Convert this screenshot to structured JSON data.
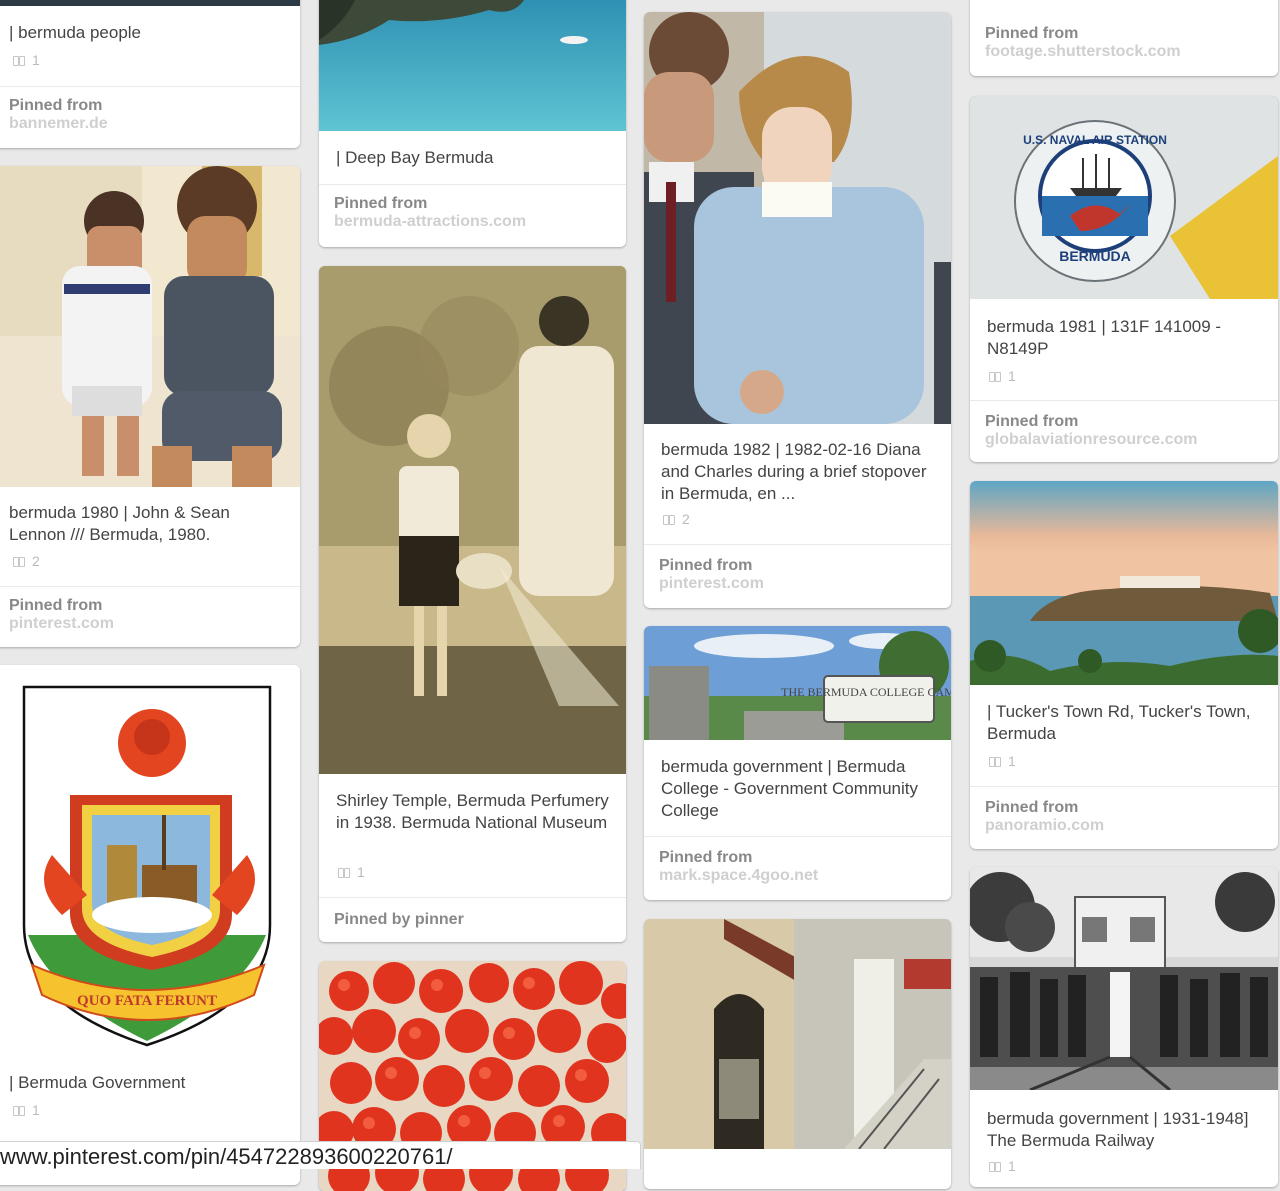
{
  "pins": [
    {
      "id": "bermuda-people",
      "description": "| bermuda people",
      "repins": "1",
      "pinned_label": "Pinned from",
      "source": "bannemer.de"
    },
    {
      "id": "lennon",
      "description": "bermuda 1980 | John & Sean Lennon /// Bermuda, 1980.",
      "repins": "2",
      "pinned_label": "Pinned from",
      "source": "pinterest.com"
    },
    {
      "id": "bermuda-government",
      "description": "| Bermuda Government",
      "repins": "1",
      "crest_motto": "QUO FATA FERUNT"
    },
    {
      "id": "deep-bay",
      "description": "| Deep Bay Bermuda",
      "pinned_label": "Pinned from",
      "source": "bermuda-attractions.com"
    },
    {
      "id": "shirley-temple",
      "description": "Shirley Temple, Bermuda Perfumery in 1938. Bermuda National Museum",
      "repins": "1",
      "pinned_label": "Pinned by pinner"
    },
    {
      "id": "diana-charles",
      "description": "bermuda 1982 | 1982-02-16 Diana and Charles during a brief stopover in Bermuda, en ...",
      "repins": "2",
      "pinned_label": "Pinned from",
      "source": "pinterest.com"
    },
    {
      "id": "bermuda-college",
      "description": "bermuda government | Bermuda College - Government Community College",
      "pinned_label": "Pinned from",
      "source": "mark.space.4goo.net",
      "sign_text": "THE BERMUDA COLLEGE CAMPUS"
    },
    {
      "id": "shutterstock",
      "pinned_label": "Pinned from",
      "source": "footage.shutterstock.com"
    },
    {
      "id": "naval-air",
      "description": "bermuda 1981 | 131F 141009 - N8149P",
      "repins": "1",
      "pinned_label": "Pinned from",
      "source": "globalaviationresource.com",
      "emblem_top": "U.S. NAVAL AIR STATION",
      "emblem_bottom": "BERMUDA"
    },
    {
      "id": "tuckers-town",
      "description": "| Tucker's Town Rd, Tucker's Town, Bermuda",
      "repins": "1",
      "pinned_label": "Pinned from",
      "source": "panoramio.com"
    },
    {
      "id": "railway",
      "description": "bermuda government | 1931-1948] The Bermuda Railway",
      "repins": "1"
    }
  ],
  "status_url": "www.pinterest.com/pin/454722893600220761/"
}
